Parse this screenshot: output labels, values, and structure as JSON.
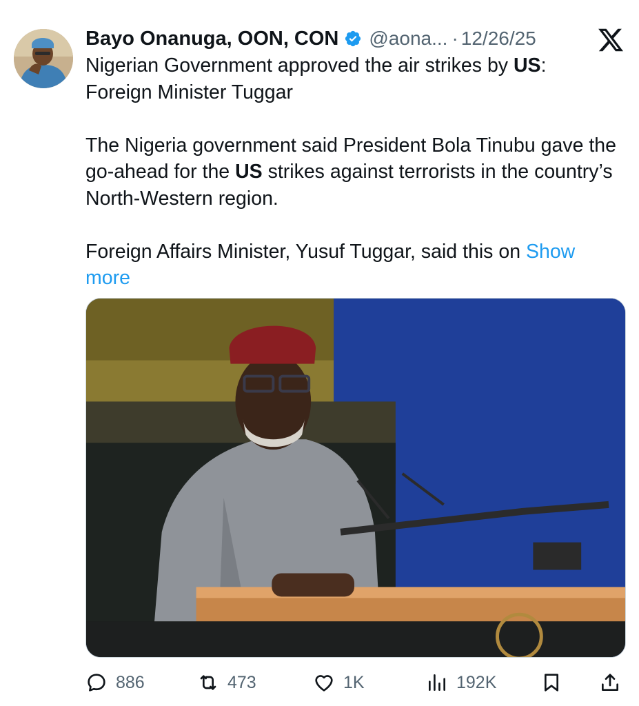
{
  "author": {
    "name": "Bayo Onanuga, OON, CON",
    "handle": "@aona...",
    "separator": "·",
    "date": "12/26/25",
    "verified": true
  },
  "post": {
    "headline_pre": "Nigerian Government approved the air strikes by ",
    "headline_bold": "US",
    "headline_post": ":",
    "headline_line2": "Foreign Minister Tuggar",
    "para2_pre": "The Nigeria government said President Bola Tinubu gave the go-ahead for the ",
    "para2_bold": "US",
    "para2_post": " strikes against terrorists in the country’s North-Western region.",
    "para3": "Foreign Affairs Minister, Yusuf Tuggar, said this on ",
    "show_more": "Show more"
  },
  "actions": {
    "replies": "886",
    "reposts": "473",
    "likes": "1K",
    "views": "192K"
  },
  "icons": {
    "verified": "verified-badge-icon",
    "logo": "x-logo-icon",
    "reply": "reply-icon",
    "repost": "repost-icon",
    "like": "heart-icon",
    "views": "views-chart-icon",
    "bookmark": "bookmark-icon",
    "share": "share-icon"
  },
  "colors": {
    "text": "#0f1419",
    "muted": "#536471",
    "link": "#1d9bf0",
    "verified": "#1d9bf0"
  }
}
